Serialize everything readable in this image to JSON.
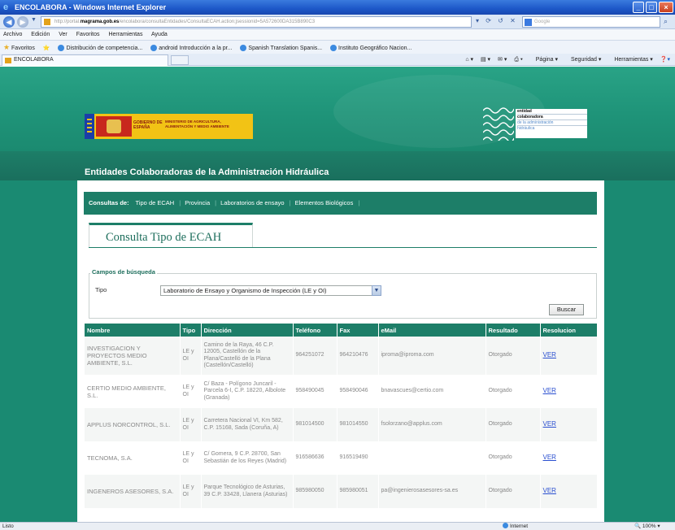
{
  "window": {
    "title": "ENCOLABORA - Windows Internet Explorer"
  },
  "address": {
    "prefix": "http://portal.",
    "host": "magrama.gob.es",
    "rest": "/encolabora/consultaEntidades/ConsultaECAH.action;jsessionid=5A572600DA315B890C3"
  },
  "search": {
    "placeholder": "Google"
  },
  "menu": {
    "items": [
      "Archivo",
      "Edición",
      "Ver",
      "Favoritos",
      "Herramientas",
      "Ayuda"
    ]
  },
  "favorites": {
    "label": "Favoritos",
    "items": [
      "Distribución de competencia...",
      "android Introducción a la pr...",
      "Spanish Translation  Spanis...",
      "Instituto Geográfico Nacion..."
    ]
  },
  "tab": {
    "title": "ENCOLABORA"
  },
  "commandbar": {
    "items": [
      "Página",
      "Seguridad",
      "Herramientas"
    ]
  },
  "banner": {
    "gov_text": "GOBIERNO DE ESPAÑA",
    "ministry_text": "MINISTERIO DE AGRICULTURA, ALIMENTACIÓN Y MEDIO AMBIENTE",
    "entidad_lines": [
      "entidad",
      "colaboradora",
      "de la administración",
      "hidráulica"
    ],
    "site_title": "Entidades Colaboradoras de la Administración Hidráulica"
  },
  "consultas": {
    "label": "Consultas de:",
    "items": [
      "Tipo de ECAH",
      "Provincia",
      "Laboratorios de ensayo",
      "Elementos Biológicos"
    ]
  },
  "page_tab": {
    "title": "Consulta Tipo de ECAH"
  },
  "search_form": {
    "legend": "Campos de búsqueda",
    "tipo_label": "Tipo",
    "tipo_value": "Laboratorio de Ensayo y Organismo de Inspección (LE y OI)",
    "buscar_label": "Buscar"
  },
  "table": {
    "headers": [
      "Nombre",
      "Tipo",
      "Dirección",
      "Teléfono",
      "Fax",
      "eMail",
      "Resultado",
      "Resolucion"
    ],
    "rows": [
      {
        "nombre": "INVESTIGACION Y PROYECTOS MEDIO AMBIENTE, S.L.",
        "tipo": "LE y OI",
        "direccion": "Camino de la Raya, 46 C.P. 12005, Castellón de la Plana/Castelló de la Plana (Castellón/Castelló)",
        "telefono": "964251072",
        "fax": "964210476",
        "email": "iproma@iproma.com",
        "resultado": "Otorgado",
        "resolucion": "VER"
      },
      {
        "nombre": "CERTIO MEDIO AMBIENTE, S.L.",
        "tipo": "LE y OI",
        "direccion": "C/ Baza - Polígono Juncaril - Parcela 6-I, C.P. 18220, Albolote (Granada)",
        "telefono": "958490045",
        "fax": "958490046",
        "email": "bnavascues@certio.com",
        "resultado": "Otorgado",
        "resolucion": "VER"
      },
      {
        "nombre": "APPLUS NORCONTROL, S.L.",
        "tipo": "LE y OI",
        "direccion": "Carretera Nacional VI, Km 582, C.P. 15168, Sada (Coruña, A)",
        "telefono": "981014500",
        "fax": "981014550",
        "email": "fsolorzano@applus.com",
        "resultado": "Otorgado",
        "resolucion": "VER"
      },
      {
        "nombre": "TECNOMA, S.A.",
        "tipo": "LE y OI",
        "direccion": "C/ Gomera, 9 C.P. 28700, San Sebastián de los Reyes (Madrid)",
        "telefono": "916586636",
        "fax": "916519490",
        "email": "",
        "resultado": "Otorgado",
        "resolucion": "VER"
      },
      {
        "nombre": "INGENEROS ASESORES, S.A.",
        "tipo": "LE y OI",
        "direccion": "Parque Tecnológico de Asturias, 39 C.P. 33428, Llanera (Asturias)",
        "telefono": "985980050",
        "fax": "985980051",
        "email": "pa@ingenierosasesores-sa.es",
        "resultado": "Otorgado",
        "resolucion": "VER"
      }
    ]
  },
  "status": {
    "left": "Listo",
    "zone": "Internet",
    "zoom": "100%"
  },
  "colors": {
    "green_dark": "#1d7e68",
    "banner_green": "#1f9479",
    "link_blue": "#2a4fd0"
  }
}
